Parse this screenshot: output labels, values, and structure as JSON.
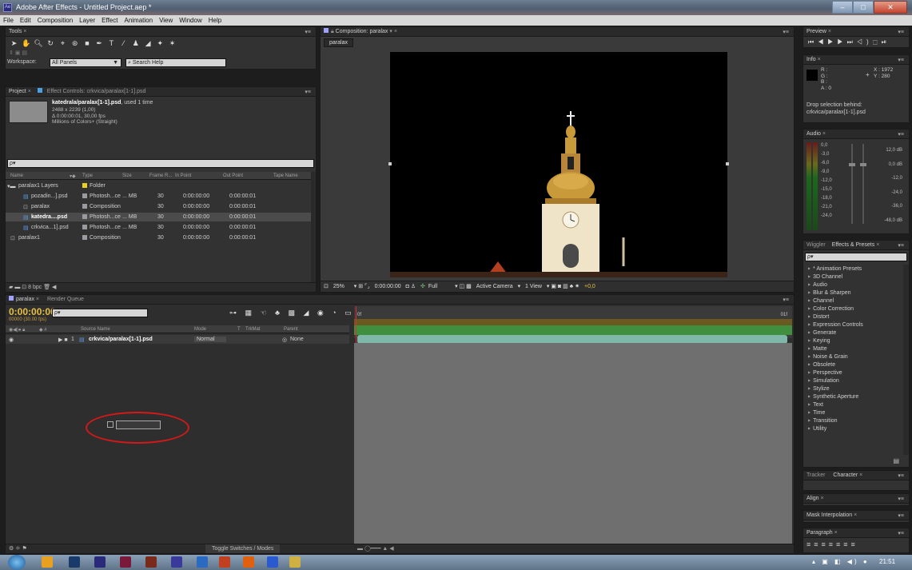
{
  "window": {
    "title": "Adobe After Effects - Untitled Project.aep *",
    "app_icon": "Ae",
    "min": "–",
    "max": "□",
    "close": "✕"
  },
  "menu": [
    "File",
    "Edit",
    "Composition",
    "Layer",
    "Effect",
    "Animation",
    "View",
    "Window",
    "Help"
  ],
  "tools": {
    "tab": "Tools",
    "workspace_label": "Workspace:",
    "workspace_value": "All Panels",
    "search_help": "Search Help"
  },
  "project": {
    "tab": "Project",
    "effect_controls_tab": "Effect Controls: crkvica/paralax[1-1].psd",
    "info_name": "katedrala/paralax[1-1].psd",
    "info_used": ", used 1 time",
    "info_lines": [
      "2488 x 2239 (1,00)",
      "Δ 0:00:00:01, 30,00 fps",
      "Millions of Colors+ (Straight)"
    ],
    "search_placeholder": "ρ▾",
    "columns": [
      "Name",
      "Type",
      "Size",
      "Frame R...",
      "In Point",
      "Out Point",
      "Tape Name"
    ],
    "rows": [
      {
        "name": "paralax1 Layers",
        "type": "Folder",
        "size": "",
        "fr": "",
        "in": "",
        "out": "",
        "color": "#e8d020"
      },
      {
        "name": "pozadin...].psd",
        "type": "Photosh...ce",
        "size": "... MB",
        "fr": "30",
        "in": "0:00:00:00",
        "out": "0:00:00:01",
        "color": "#9a9aa0"
      },
      {
        "name": "paralax",
        "type": "Composition",
        "size": "",
        "fr": "30",
        "in": "0:00:00:00",
        "out": "0:00:00:01",
        "color": "#9a9aa0"
      },
      {
        "name": "katedra....psd",
        "type": "Photosh...ce",
        "size": "... MB",
        "fr": "30",
        "in": "0:00:00:00",
        "out": "0:00:00:01",
        "color": "#9a9aa0"
      },
      {
        "name": "crkvica...1].psd",
        "type": "Photosh...ce",
        "size": "... MB",
        "fr": "30",
        "in": "0:00:00:00",
        "out": "0:00:00:01",
        "color": "#9a9aa0"
      },
      {
        "name": "paralax1",
        "type": "Composition",
        "size": "",
        "fr": "30",
        "in": "0:00:00:00",
        "out": "0:00:00:01",
        "color": "#9a9aa0"
      }
    ],
    "bpc": "8 bpc"
  },
  "composition": {
    "tab": "Composition: paralax",
    "sub_tab": "paralax",
    "zoom": "25%",
    "timecode": "0:00:00:00",
    "resolution": "Full",
    "camera": "Active Camera",
    "views": "1 View",
    "exposure": "+0,0"
  },
  "timeline": {
    "tab": "paralax",
    "render_tab": "Render Queue",
    "timecode": "0:00:00:00",
    "fps": "00000 (30.00 fps)",
    "search_placeholder": "ρ▾",
    "columns": {
      "source": "Source Name",
      "mode": "Mode",
      "t": "T",
      "trkmat": "TrkMat",
      "parent": "Parent"
    },
    "layer": {
      "num": "1",
      "name": "crkvica/paralax[1-1].psd",
      "mode": "Normal",
      "parent": "None"
    },
    "ruler_start": "0f",
    "ruler_end": "01f",
    "toggle": "Toggle Switches / Modes"
  },
  "preview": {
    "tab": "Preview"
  },
  "info": {
    "tab": "Info",
    "r": "R :",
    "g": "G :",
    "b": "B :",
    "a": "A : 0",
    "x": "X : 1972",
    "y": "Y : 280",
    "drop_line1": "Drop selection behind:",
    "drop_line2": "crkvica/paralax[1-1].psd"
  },
  "audio": {
    "tab": "Audio",
    "left_scale": [
      "0,0",
      "-3,0",
      "-6,0",
      "-9,0",
      "-12,0",
      "-15,0",
      "-18,0",
      "-21,0",
      "-24,0"
    ],
    "right_scale": [
      "12,0 dB",
      "0,0 dB",
      "-12,0",
      "-24,0",
      "-36,0",
      "-48,0 dB"
    ]
  },
  "effects": {
    "wiggler_tab": "Wiggler",
    "tab": "Effects & Presets",
    "search_placeholder": "ρ▾",
    "items": [
      "* Animation Presets",
      "3D Channel",
      "Audio",
      "Blur & Sharpen",
      "Channel",
      "Color Correction",
      "Distort",
      "Expression Controls",
      "Generate",
      "Keying",
      "Matte",
      "Noise & Grain",
      "Obsolete",
      "Perspective",
      "Simulation",
      "Stylize",
      "Synthetic Aperture",
      "Text",
      "Time",
      "Transition",
      "Utility"
    ]
  },
  "small_panels": {
    "tracker": "Tracker",
    "character": "Character",
    "align": "Align",
    "mask": "Mask Interpolation",
    "paragraph": "Paragraph"
  },
  "taskbar": {
    "clock": "21:51"
  }
}
